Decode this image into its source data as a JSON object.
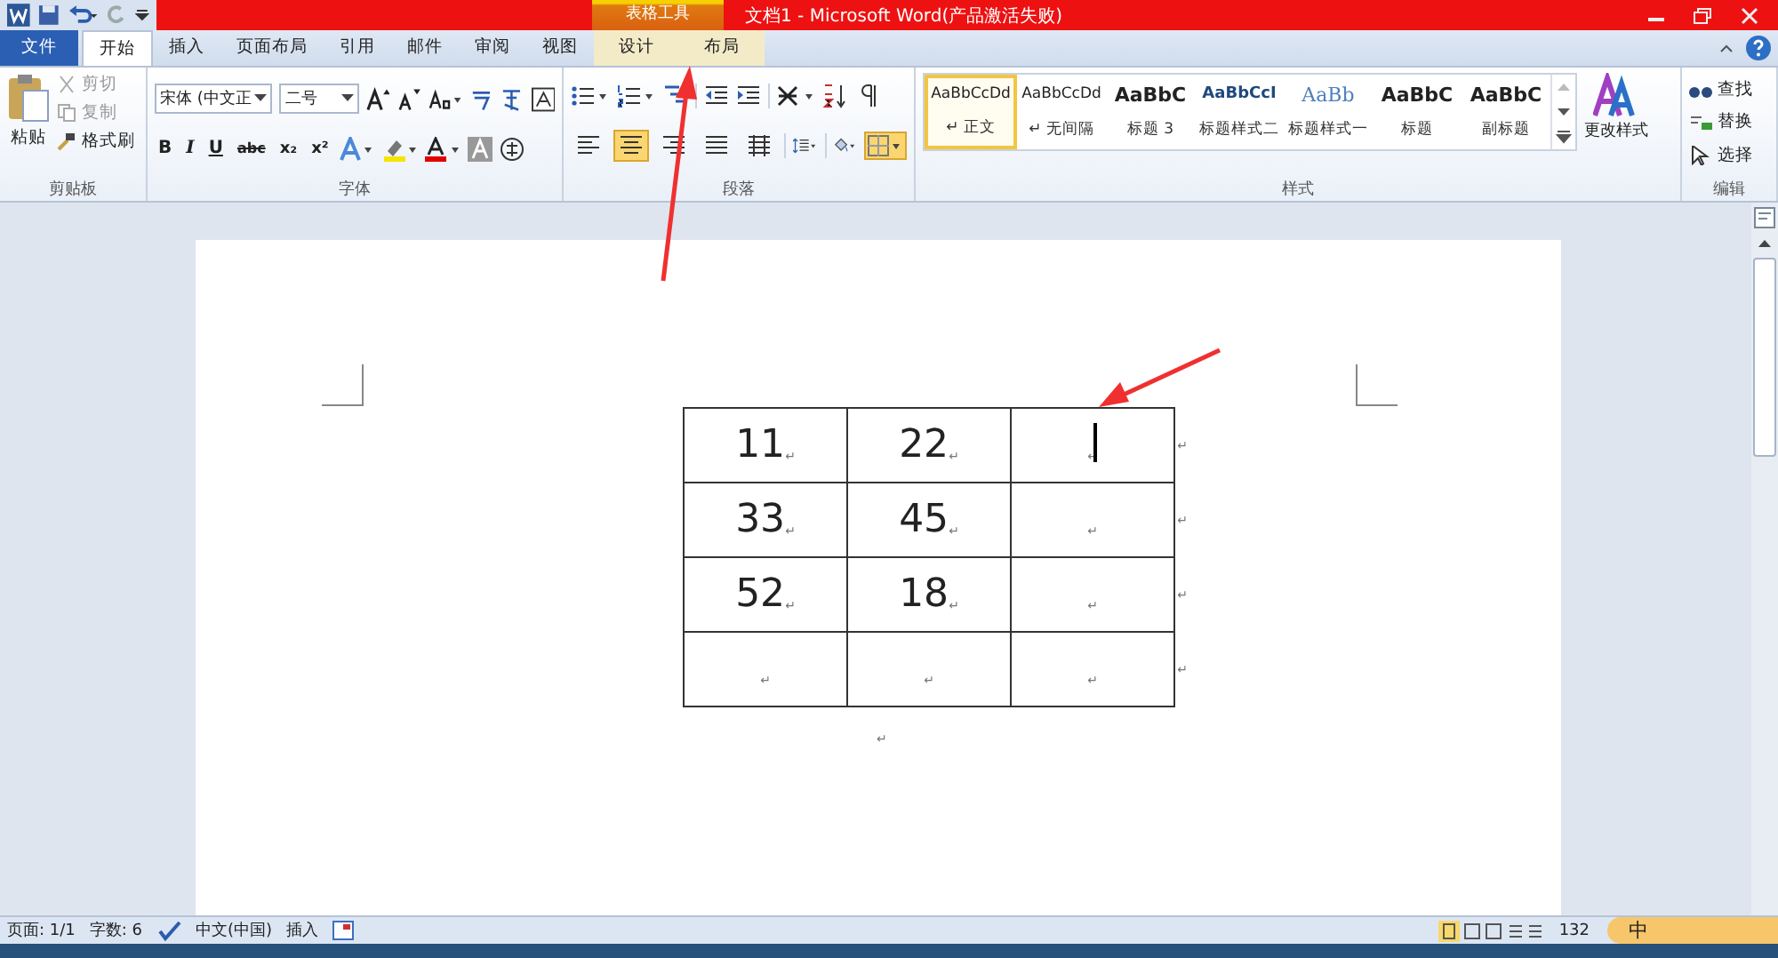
{
  "window": {
    "title": "文档1 - Microsoft Word(产品激活失败)",
    "context_group": "表格工具"
  },
  "tabs": [
    {
      "label": "文件",
      "kind": "file",
      "selected": false
    },
    {
      "label": "开始",
      "kind": "normal",
      "selected": true
    },
    {
      "label": "插入",
      "kind": "normal",
      "selected": false
    },
    {
      "label": "页面布局",
      "kind": "normal",
      "selected": false
    },
    {
      "label": "引用",
      "kind": "normal",
      "selected": false
    },
    {
      "label": "邮件",
      "kind": "normal",
      "selected": false
    },
    {
      "label": "审阅",
      "kind": "normal",
      "selected": false
    },
    {
      "label": "视图",
      "kind": "normal",
      "selected": false
    },
    {
      "label": "设计",
      "kind": "context",
      "selected": false
    },
    {
      "label": "布局",
      "kind": "context",
      "selected": false
    }
  ],
  "clipboard": {
    "paste": "粘贴",
    "cut": "剪切",
    "copy": "复制",
    "format_painter": "格式刷",
    "group": "剪贴板"
  },
  "font": {
    "name": "宋体 (中文正",
    "size": "二号",
    "group": "字体",
    "format_buttons": [
      "B",
      "I",
      "U",
      "abc",
      "x₂",
      "x²"
    ]
  },
  "paragraph": {
    "group": "段落",
    "align_buttons": [
      {
        "selected": false
      },
      {
        "selected": true
      },
      {
        "selected": false
      },
      {
        "selected": false
      },
      {
        "selected": false
      }
    ],
    "borders_on": true
  },
  "styles": {
    "group": "样式",
    "items": [
      {
        "preview": "AaBbCcDd",
        "name": "↵ 正文",
        "kind": "normal",
        "selected": true
      },
      {
        "preview": "AaBbCcDd",
        "name": "↵ 无间隔",
        "kind": "normal",
        "selected": false
      },
      {
        "preview": "AaBbC",
        "name": "标题 3",
        "kind": "heading",
        "selected": false
      },
      {
        "preview": "AaBbCcI",
        "name": "标题样式二",
        "kind": "blue",
        "selected": false
      },
      {
        "preview": "AaBb",
        "name": "标题样式一",
        "kind": "light",
        "selected": false
      },
      {
        "preview": "AaBbC",
        "name": "标题",
        "kind": "heading",
        "selected": false
      },
      {
        "preview": "AaBbC",
        "name": "副标题",
        "kind": "heading",
        "selected": false
      }
    ],
    "change": "更改样式"
  },
  "editing": {
    "group": "编辑",
    "find": "查找",
    "replace": "替换",
    "select": "选择"
  },
  "table": {
    "rows": [
      {
        "end_mark": "↵",
        "cells": [
          {
            "text": "11",
            "mark": "↵"
          },
          {
            "text": "22",
            "mark": "↵"
          },
          {
            "text": "",
            "mark": "↵",
            "cursor": true
          }
        ]
      },
      {
        "end_mark": "↵",
        "cells": [
          {
            "text": "33",
            "mark": "↵"
          },
          {
            "text": "45",
            "mark": "↵"
          },
          {
            "text": "",
            "mark": "↵",
            "cursor": false
          }
        ]
      },
      {
        "end_mark": "↵",
        "cells": [
          {
            "text": "52",
            "mark": "↵"
          },
          {
            "text": "18",
            "mark": "↵"
          },
          {
            "text": "",
            "mark": "↵",
            "cursor": false
          }
        ]
      },
      {
        "end_mark": "↵",
        "cells": [
          {
            "text": "",
            "mark": "↵",
            "cursor": false
          },
          {
            "text": "",
            "mark": "↵",
            "cursor": false
          },
          {
            "text": "",
            "mark": "↵",
            "cursor": false
          }
        ]
      }
    ],
    "after_mark": "↵"
  },
  "status_bar": {
    "page": "页面: 1/1",
    "words": "字数: 6",
    "language": "中文(中国)",
    "mode": "插入",
    "zoom": "132",
    "ime": "中"
  }
}
